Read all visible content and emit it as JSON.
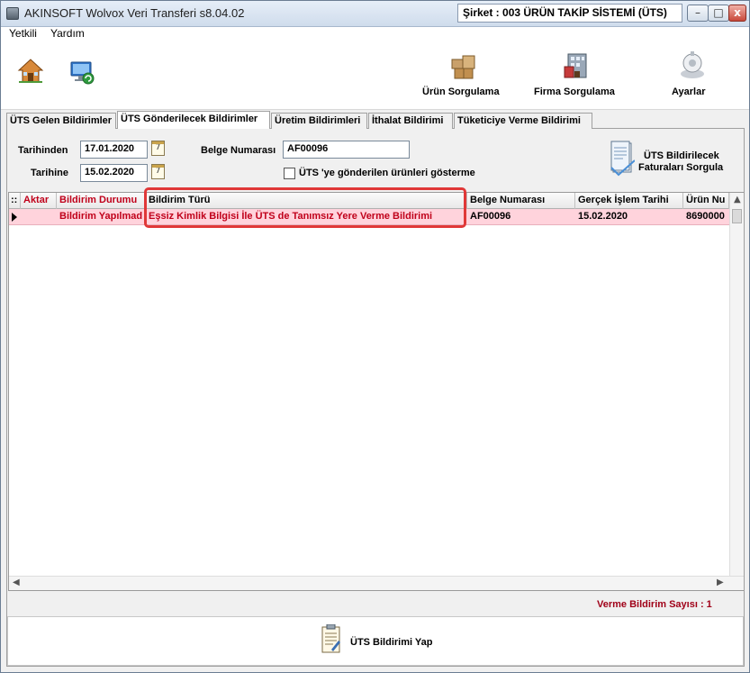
{
  "window": {
    "title": "AKINSOFT Wolvox Veri Transferi s8.04.02",
    "company": "Şirket : 003 ÜRÜN TAKİP SİSTEMİ (ÜTS)",
    "min_glyph": "–",
    "max_glyph": "□",
    "close_glyph": "x"
  },
  "menu": {
    "items": [
      "Yetkili",
      "Yardım"
    ]
  },
  "toolbar": {
    "urun_sorgulama": "Ürün Sorgulama",
    "firma_sorgulama": "Firma Sorgulama",
    "ayarlar": "Ayarlar"
  },
  "tabs": [
    "ÜTS Gelen Bildirimler",
    "ÜTS Gönderilecek Bildirimler",
    "Üretim Bildirimleri",
    "İthalat Bildirimi",
    "Tüketiciye Verme Bildirimi"
  ],
  "filters": {
    "tarihinden_label": "Tarihinden",
    "tarihinden_value": "17.01.2020",
    "tarihine_label": "Tarihine",
    "tarihine_value": "15.02.2020",
    "belge_label": "Belge Numarası",
    "belge_value": "AF00096",
    "checkbox_label": "ÜTS 'ye gönderilen ürünleri gösterme",
    "calendar_glyph": "7",
    "sorgula_line1": "ÜTS Bildirilecek",
    "sorgula_line2": "Faturaları Sorgula"
  },
  "grid": {
    "corner": "::",
    "columns": [
      "Aktar",
      "Bildirim Durumu",
      "Bildirim Türü",
      "Belge Numarası",
      "Gerçek İşlem Tarihi",
      "Ürün Nu"
    ],
    "rows": [
      {
        "aktar": "",
        "durum": "Bildirim Yapılmad",
        "tur": "Eşsiz Kimlik Bilgisi İle ÜTS de Tanımsız Yere Verme Bildirimi",
        "belge": "AF00096",
        "tarih": "15.02.2020",
        "urun": "8690000"
      }
    ]
  },
  "footer": {
    "count_text": "Verme Bildirim Sayısı : 1",
    "action_button": "ÜTS Bildirimi Yap"
  }
}
